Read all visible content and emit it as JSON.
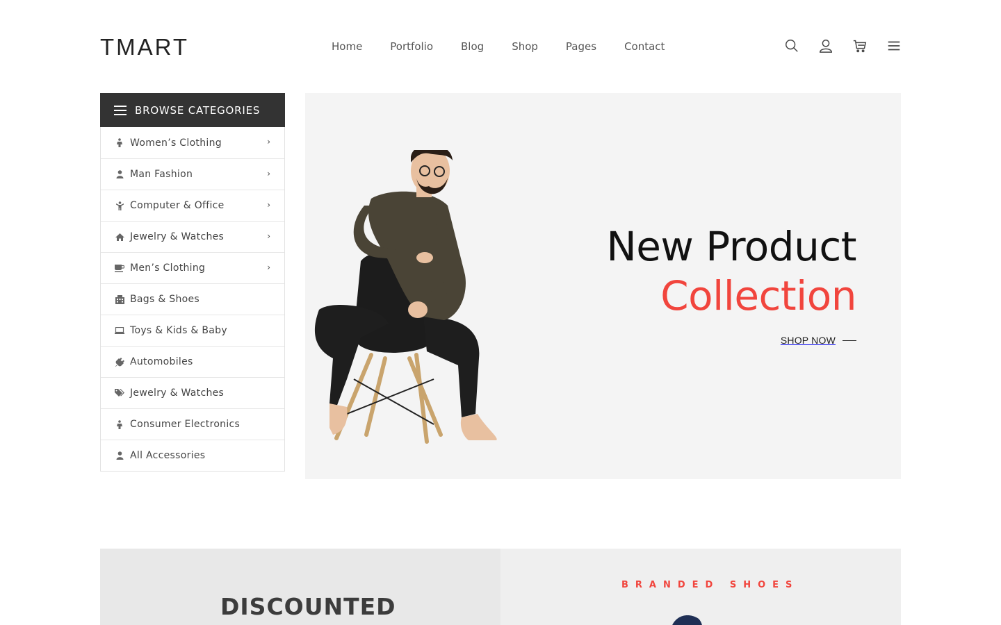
{
  "header": {
    "logo": "TMART",
    "nav": [
      "Home",
      "Portfolio",
      "Blog",
      "Shop",
      "Pages",
      "Contact"
    ],
    "icons": [
      "search-icon",
      "user-icon",
      "cart-icon",
      "menu-icon"
    ]
  },
  "sidebar": {
    "title": "BROWSE CATEGORIES",
    "items": [
      {
        "label": "Women’s Clothing",
        "icon": "female-icon",
        "has_submenu": true
      },
      {
        "label": "Man Fashion",
        "icon": "user-icon",
        "has_submenu": true
      },
      {
        "label": "Computer & Office",
        "icon": "child-icon",
        "has_submenu": true
      },
      {
        "label": "Jewelry & Watches",
        "icon": "home-icon",
        "has_submenu": true
      },
      {
        "label": "Men’s Clothing",
        "icon": "coffee-icon",
        "has_submenu": true
      },
      {
        "label": "Bags & Shoes",
        "icon": "building-icon",
        "has_submenu": false
      },
      {
        "label": "Toys & Kids & Baby",
        "icon": "laptop-icon",
        "has_submenu": false
      },
      {
        "label": "Automobiles",
        "icon": "plug-icon",
        "has_submenu": false
      },
      {
        "label": "Jewelry & Watches",
        "icon": "tags-icon",
        "has_submenu": false
      },
      {
        "label": "Consumer Electronics",
        "icon": "female-icon",
        "has_submenu": false
      },
      {
        "label": "All Accessories",
        "icon": "user-icon",
        "has_submenu": false
      }
    ],
    "chevron": "›"
  },
  "hero": {
    "title_line1": "New Product",
    "title_line2": "Collection",
    "cta": "SHOP NOW",
    "accent_color": "#f1453d"
  },
  "banners": {
    "left_text": "DISCOUNTED",
    "right_text": "BRANDED SHOES"
  }
}
